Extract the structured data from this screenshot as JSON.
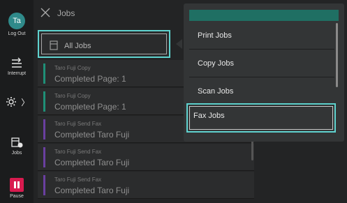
{
  "sidebar": {
    "user_initials": "Ta",
    "logout_label": "Log Out",
    "interrupt_label": "Interrupt",
    "settings_chevron": "〉",
    "jobs_label": "Jobs",
    "pause_label": "Pause",
    "pause_color": "#d81b4f",
    "avatar_color": "#2f8a8a"
  },
  "header": {
    "title": "Jobs"
  },
  "filter": {
    "label": "All Jobs"
  },
  "jobs": [
    {
      "sub": "Taro Fuji   Copy",
      "main": "Completed  Page: 1",
      "color": "#1f8f77"
    },
    {
      "sub": "Taro Fuji   Copy",
      "main": "Completed  Page: 1",
      "color": "#1f8f77"
    },
    {
      "sub": "Taro Fuji   Send Fax",
      "main": "Completed  Taro Fuji",
      "color": "#6a3fa0"
    },
    {
      "sub": "Taro Fuji   Send Fax",
      "main": "Completed  Taro Fuji",
      "color": "#6a3fa0"
    },
    {
      "sub": "Taro Fuji   Send Fax",
      "main": "Completed  Taro Fuji",
      "color": "#6a3fa0"
    }
  ],
  "menu": {
    "header_color": "#1f6f63",
    "items": [
      {
        "label": "Print Jobs"
      },
      {
        "label": "Copy Jobs"
      },
      {
        "label": "Scan Jobs"
      },
      {
        "label": "Fax Jobs",
        "selected": true
      }
    ]
  },
  "accent": "#5fd3cf"
}
